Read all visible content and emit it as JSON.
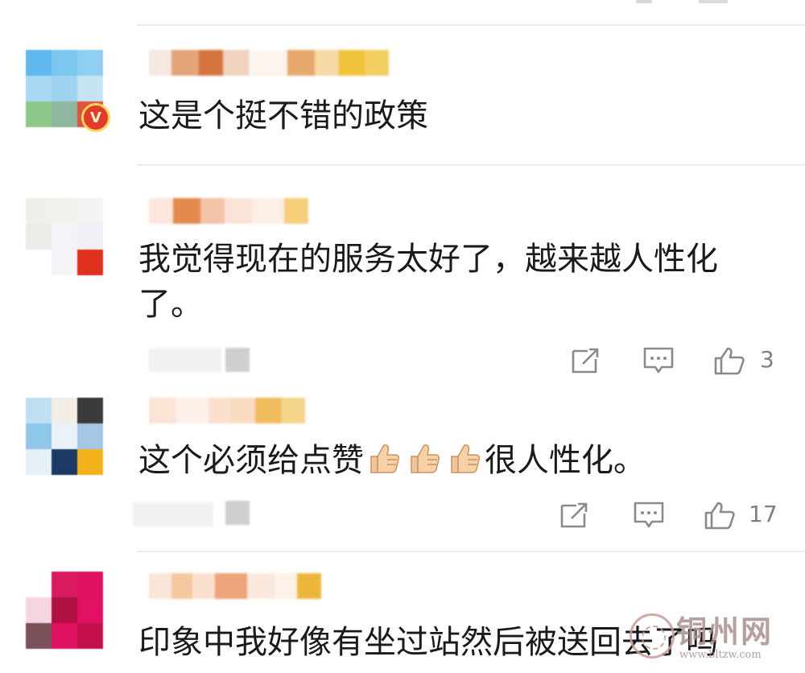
{
  "comments": [
    {
      "text": "这是个挺不错的政策",
      "verified_badge": "V",
      "likes": ""
    },
    {
      "text": "我觉得现在的服务太好了，越来越人性化了。",
      "likes": "3"
    },
    {
      "text_before": "这个必须给点赞",
      "text_after": "很人性化。",
      "emoji": "thumbs-up",
      "emoji_count": 3,
      "likes": "17"
    },
    {
      "text": "印象中我好像有坐过站然后被送回去了吗"
    }
  ],
  "icons": {
    "share": "share-icon",
    "comment": "comment-icon",
    "like": "thumbs-up-icon"
  },
  "watermark": {
    "title": "铜州网",
    "url": "www.bltzw.com"
  },
  "colors": {
    "text": "#1a1a1a",
    "meta": "#808080",
    "divider": "#ececec",
    "badge": "#e33b2b"
  }
}
